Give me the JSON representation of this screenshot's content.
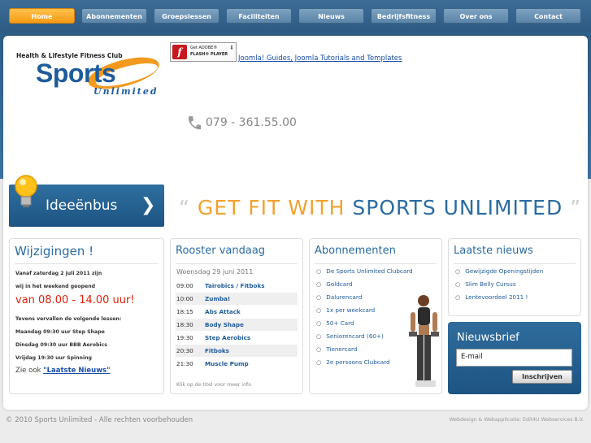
{
  "nav": {
    "items": [
      "Home",
      "Abonnementen",
      "Groepslessen",
      "Faciliteiten",
      "Nieuws",
      "Bedrijfsfitness",
      "Over ons",
      "Contact"
    ],
    "active": "Home"
  },
  "logo": {
    "tagline": "Health & Lifestyle Fitness Club",
    "sports": "Sports",
    "unlimited": "Unlimited"
  },
  "flash": {
    "get": "Get ADOBE®",
    "name": "FLASH® PLAYER",
    "link": "Joomla! Guides, Joomla Tutorials and Templates"
  },
  "phone": "079 - 361.55.00",
  "idee": "Ideeënbus",
  "slogan": {
    "part1": "GET FIT WITH",
    "part2": "SPORTS UNLIMITED"
  },
  "wijzigingen": {
    "title": "Wijzigingen !",
    "line1": "Vanaf zaterdag 2 juli 2011 zijn",
    "line2": "wij in het weekend geopend",
    "time": "van 08.00 - 14.00 uur!",
    "line3": "Tevens vervallen de volgende lessen:",
    "line4": "Maandag 09:30 uur Step Shape",
    "line5": "Dinsdag 09:30 uur BBB Aerobics",
    "line6": "Vrijdag 19:30 uur Spinning",
    "zie": "Zie ook",
    "zie_link": "\"Laatste Nieuws\""
  },
  "rooster": {
    "title": "Rooster vandaag",
    "date": "Woensdag 29 juni 2011",
    "rows": [
      {
        "time": "09:00",
        "class": "Tairobics / Fitboks"
      },
      {
        "time": "10:00",
        "class": "Zumba!"
      },
      {
        "time": "18:15",
        "class": "Abs Attack"
      },
      {
        "time": "18:30",
        "class": "Body Shape"
      },
      {
        "time": "19:30",
        "class": "Step Aerobics"
      },
      {
        "time": "20:30",
        "class": "Fitboks"
      },
      {
        "time": "21:30",
        "class": "Muscle Pump"
      }
    ],
    "hint": "Klik op de titel voor meer info"
  },
  "abonnementen": {
    "title": "Abonnementen",
    "items": [
      "De Sports Unlimited Clubcard",
      "Goldcard",
      "Dalurencard",
      "1x per weekcard",
      "50+ Card",
      "Seniorencard (60+)",
      "Tienercard",
      "2e persoons Clubcard"
    ]
  },
  "nieuws": {
    "title": "Laatste nieuws",
    "items": [
      "Gewijzigde Openingstijden",
      "Slim Belly Cursus",
      "Lentevoordeel 2011 !"
    ]
  },
  "nieuwsbrief": {
    "title": "Nieuwsbrief",
    "email_value": "E-mail",
    "button": "Inschrijven"
  },
  "footer": {
    "left": "© 2010 Sports Unlimited - Alle rechten voorbehouden",
    "right": "Webdesign & Webapplicatie: Edit4U Webservices B.V."
  },
  "colors": {
    "accent": "#f0a231",
    "brand": "#2a6ca2",
    "alert": "#e1210a"
  }
}
